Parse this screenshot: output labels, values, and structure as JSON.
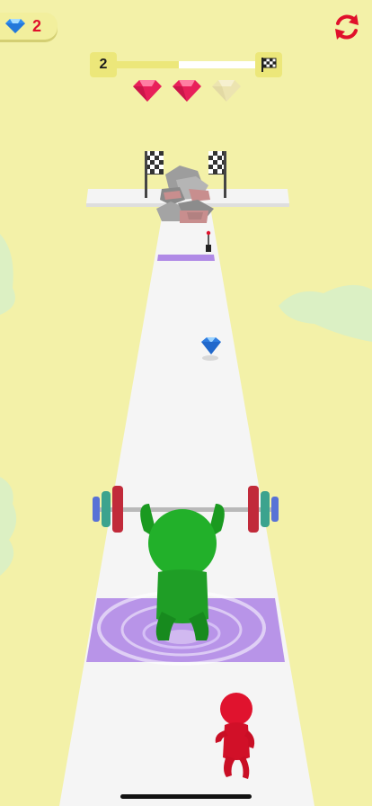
{
  "hud": {
    "gem_count": "2",
    "level": "2",
    "progress": 0.45,
    "rating": {
      "earned": 2,
      "total": 3
    }
  },
  "colors": {
    "background": "#f3f1a8",
    "track": "#f7f7f7",
    "purple_pad": "#b894e8",
    "player": "#1fa524",
    "rival": "#e0132e",
    "gem_earned": "#e8205a",
    "gem_empty": "#ece4b0",
    "restart": "#e0102b"
  },
  "icons": [
    "diamond-icon",
    "restart-icon",
    "finish-flag-icon",
    "ruby-icon"
  ]
}
